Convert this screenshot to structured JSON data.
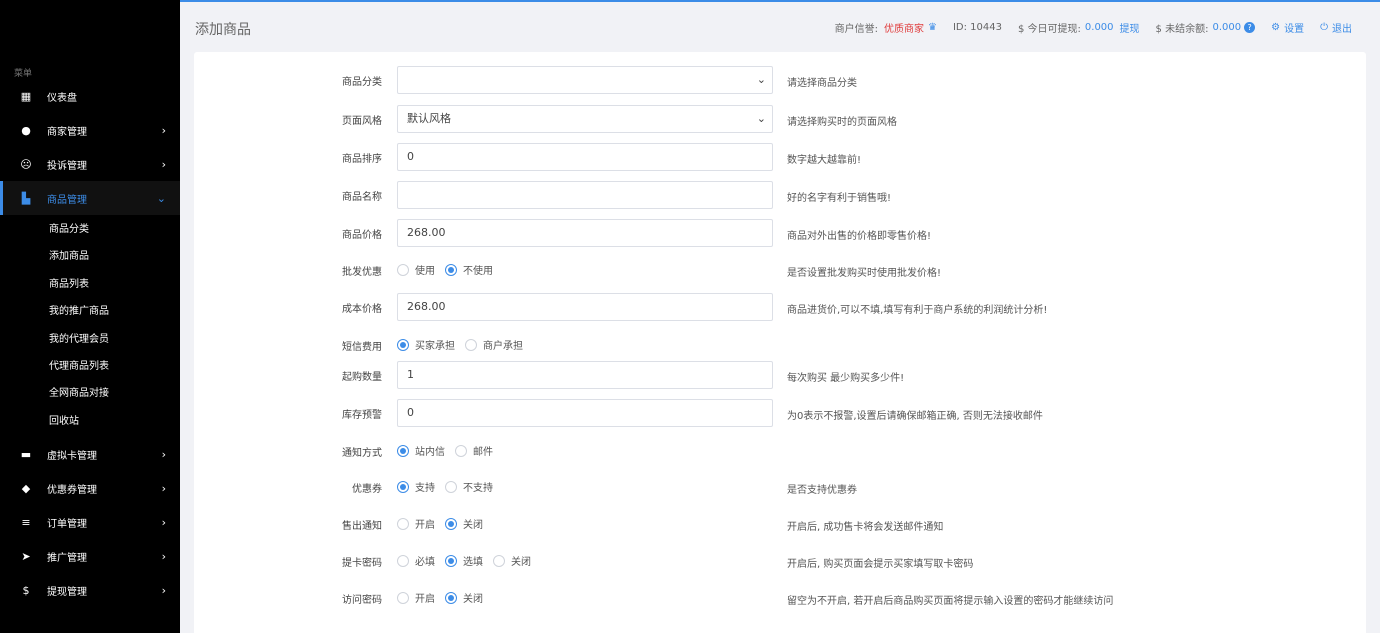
{
  "header": {
    "title": "添加商品",
    "credit_label": "商户信誉:",
    "credit_value": "优质商家",
    "id_text": "ID: 10443",
    "withdrawable_label": "$ 今日可提现:",
    "withdrawable_value": "0.000",
    "withdraw_link": "提现",
    "unsettled_label": "$ 未结余额:",
    "unsettled_value": "0.000",
    "settings": "设置",
    "logout": "退出"
  },
  "sidebar": {
    "caption": "菜单",
    "items": [
      {
        "label": "仪表盘",
        "icon": "dashboard-icon"
      },
      {
        "label": "商家管理",
        "icon": "user-icon"
      },
      {
        "label": "投诉管理",
        "icon": "frown-icon"
      },
      {
        "label": "商品管理",
        "icon": "shopping-bag-icon"
      },
      {
        "label": "虚拟卡管理",
        "icon": "credit-card-icon"
      },
      {
        "label": "优惠券管理",
        "icon": "tag-icon"
      },
      {
        "label": "订单管理",
        "icon": "list-icon"
      },
      {
        "label": "推广管理",
        "icon": "send-icon"
      },
      {
        "label": "提现管理",
        "icon": "dollar-icon"
      }
    ],
    "subitems": [
      "商品分类",
      "添加商品",
      "商品列表",
      "我的推广商品",
      "我的代理会员",
      "代理商品列表",
      "全网商品对接",
      "回收站"
    ]
  },
  "form": {
    "category": {
      "label": "商品分类",
      "value": "",
      "help": "请选择商品分类"
    },
    "style": {
      "label": "页面风格",
      "value": "默认风格",
      "help": "请选择购买时的页面风格"
    },
    "sort": {
      "label": "商品排序",
      "value": "0",
      "help": "数字越大越靠前!"
    },
    "name": {
      "label": "商品名称",
      "value": "",
      "help": "好的名字有利于销售哦!"
    },
    "price": {
      "label": "商品价格",
      "value": "268.00",
      "help": "商品对外出售的价格即零售价格!"
    },
    "wholesale": {
      "label": "批发优惠",
      "options": [
        "使用",
        "不使用"
      ],
      "selected": "不使用",
      "help": "是否设置批发购买时使用批发价格!"
    },
    "cost": {
      "label": "成本价格",
      "value": "268.00",
      "help": "商品进货价,可以不填,填写有利于商户系统的利润统计分析!"
    },
    "sms": {
      "label": "短信费用",
      "options": [
        "买家承担",
        "商户承担"
      ],
      "selected": "买家承担"
    },
    "min_qty": {
      "label": "起购数量",
      "value": "1",
      "help": "每次购买 最少购买多少件!"
    },
    "stock_alert": {
      "label": "库存预警",
      "value": "0",
      "help": "为0表示不报警,设置后请确保邮箱正确, 否则无法接收邮件"
    },
    "notify": {
      "label": "通知方式",
      "options": [
        "站内信",
        "邮件"
      ],
      "selected": "站内信"
    },
    "coupon": {
      "label": "优惠券",
      "options": [
        "支持",
        "不支持"
      ],
      "selected": "支持",
      "help": "是否支持优惠券"
    },
    "sold_notify": {
      "label": "售出通知",
      "options": [
        "开启",
        "关闭"
      ],
      "selected": "关闭",
      "help": "开启后, 成功售卡将会发送邮件通知"
    },
    "card_pwd": {
      "label": "提卡密码",
      "options": [
        "必填",
        "选填",
        "关闭"
      ],
      "selected": "选填",
      "help": "开启后, 购买页面会提示买家填写取卡密码"
    },
    "access_pwd": {
      "label": "访问密码",
      "options": [
        "开启",
        "关闭"
      ],
      "selected": "关闭",
      "help": "留空为不开启, 若开启后商品购买页面将提示输入设置的密码才能继续访问"
    }
  },
  "colors": {
    "accent": "#3c8ce7",
    "sidebar": "#000000",
    "danger": "#e03c3c"
  }
}
